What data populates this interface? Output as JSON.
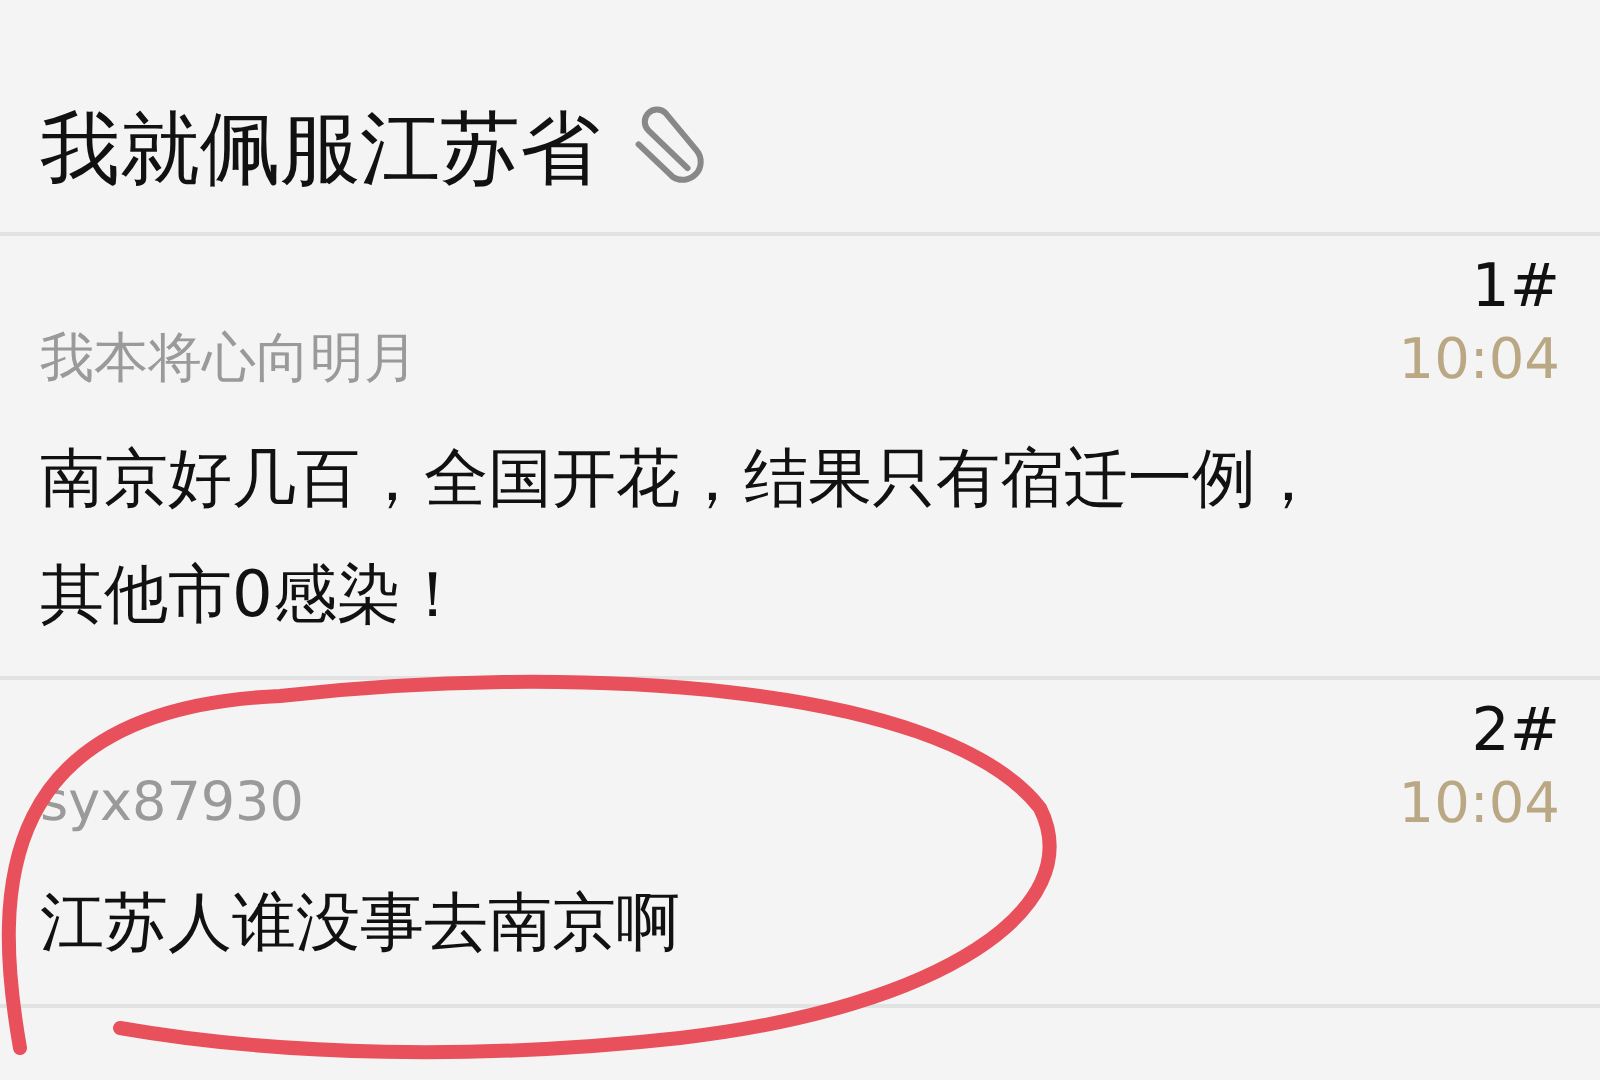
{
  "thread": {
    "title": "我就佩服江苏省"
  },
  "posts": [
    {
      "floor": "1#",
      "author": "我本将心向明月",
      "time": "10:04",
      "body": "南京好几百，全国开花，结果只有宿迁一例，其他市0感染！",
      "circled": false
    },
    {
      "floor": "2#",
      "author": "syx87930",
      "time": "10:04",
      "body": "江苏人谁没事去南京啊",
      "circled": true
    }
  ]
}
